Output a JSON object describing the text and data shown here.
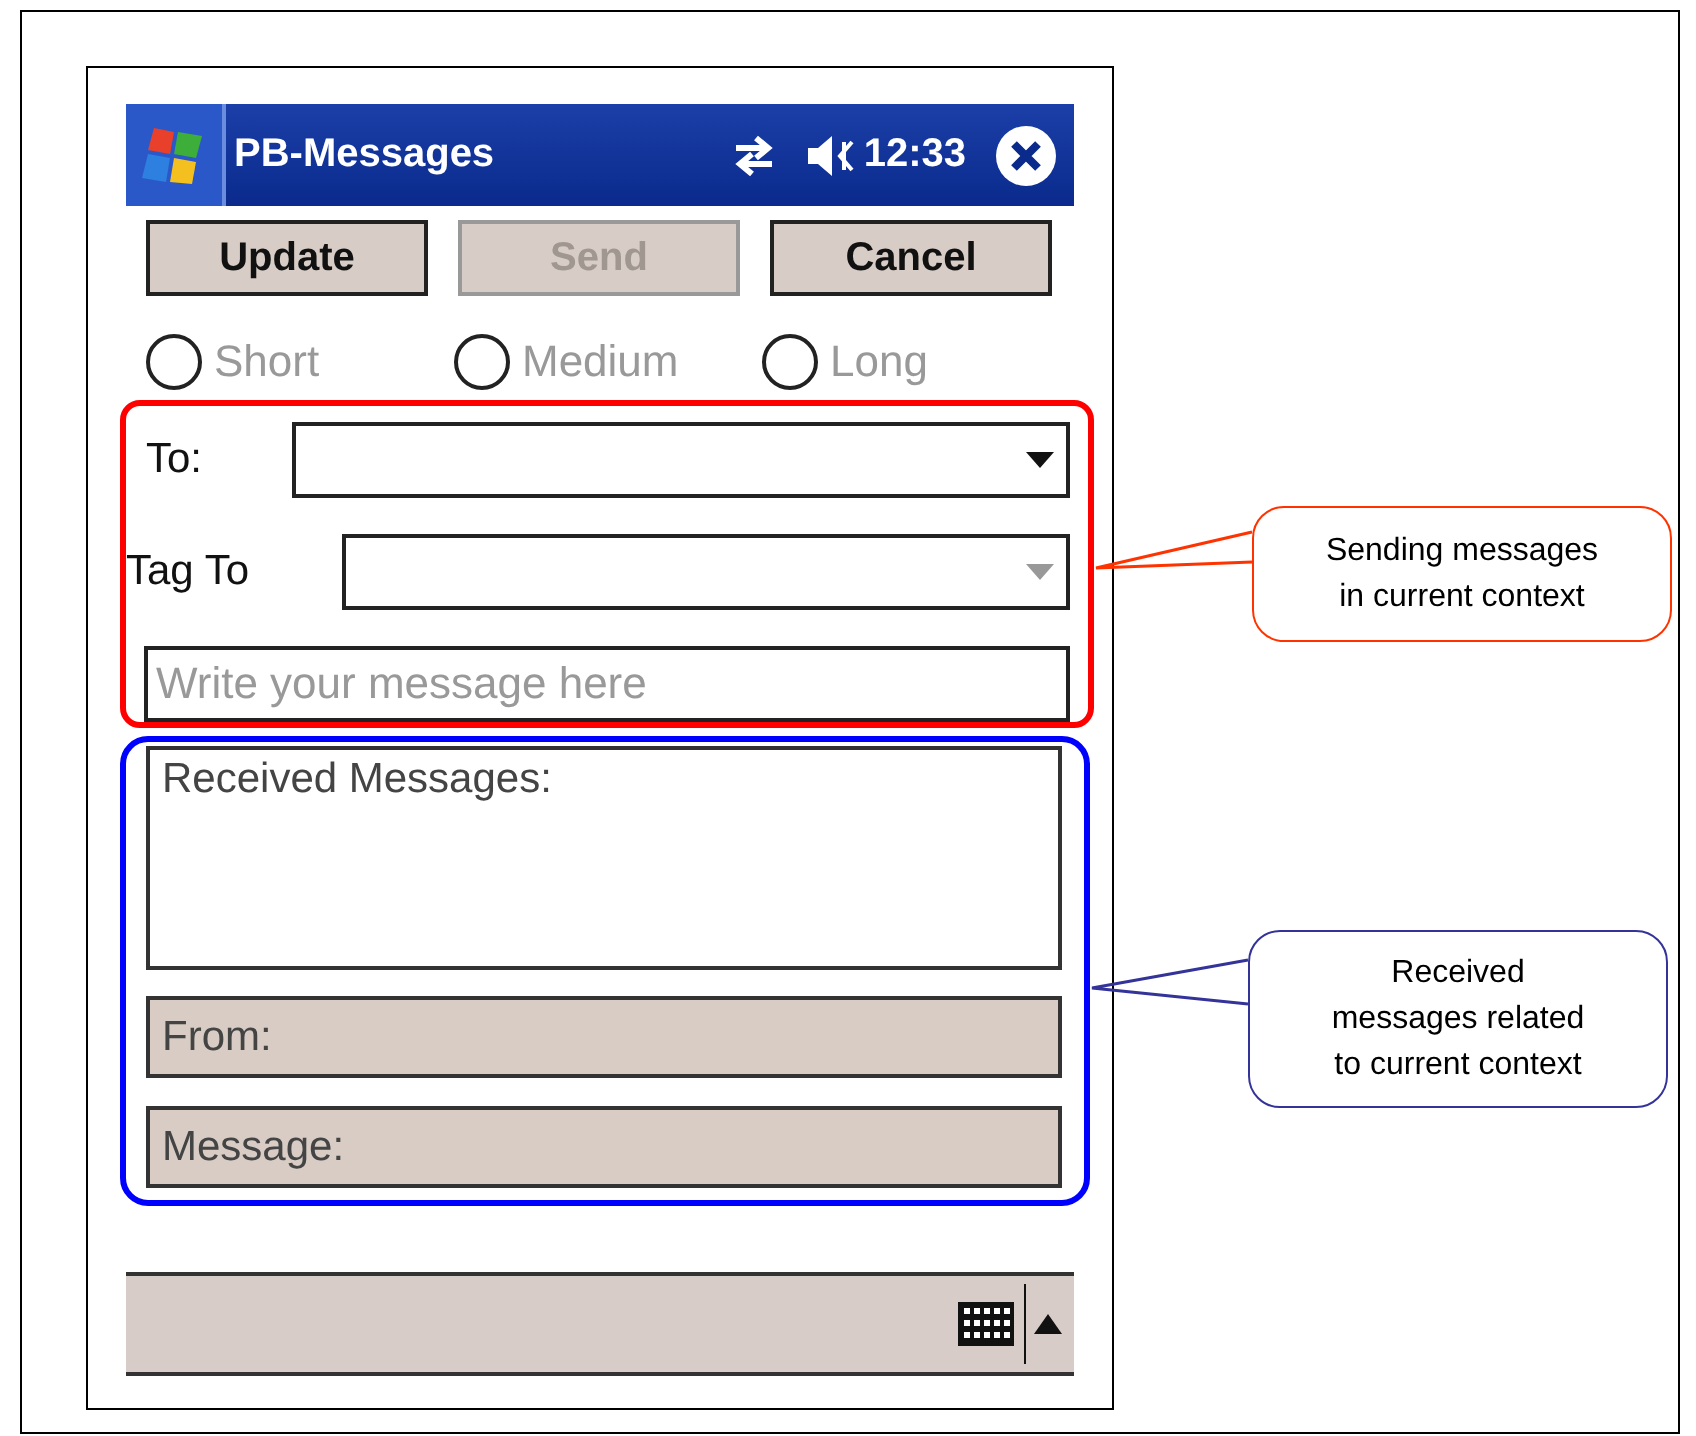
{
  "title_bar": {
    "title": "PB-Messages",
    "time": "12:33"
  },
  "buttons": [
    {
      "label": "Update",
      "disabled": false
    },
    {
      "label": "Send",
      "disabled": true
    },
    {
      "label": "Cancel",
      "disabled": false
    }
  ],
  "length_options": [
    {
      "label": "Short",
      "selected": false,
      "disabled": true
    },
    {
      "label": "Medium",
      "selected": false,
      "disabled": true
    },
    {
      "label": "Long",
      "selected": false,
      "disabled": true
    }
  ],
  "send_section": {
    "to": {
      "label": "To:",
      "disabled": false
    },
    "tag_to": {
      "label": "Tag To",
      "disabled": true
    },
    "message": {
      "placeholder": "Write your message here"
    }
  },
  "receive_section": {
    "received": {
      "label": "Received Messages:"
    },
    "from": {
      "label": "From:"
    },
    "message": {
      "label": "Message:"
    }
  },
  "callouts": [
    {
      "text": "Sending messages\nin current context",
      "color": "#ff3300"
    },
    {
      "text": "Received\nmessages related\nto current context",
      "color": "#333399"
    }
  ]
}
